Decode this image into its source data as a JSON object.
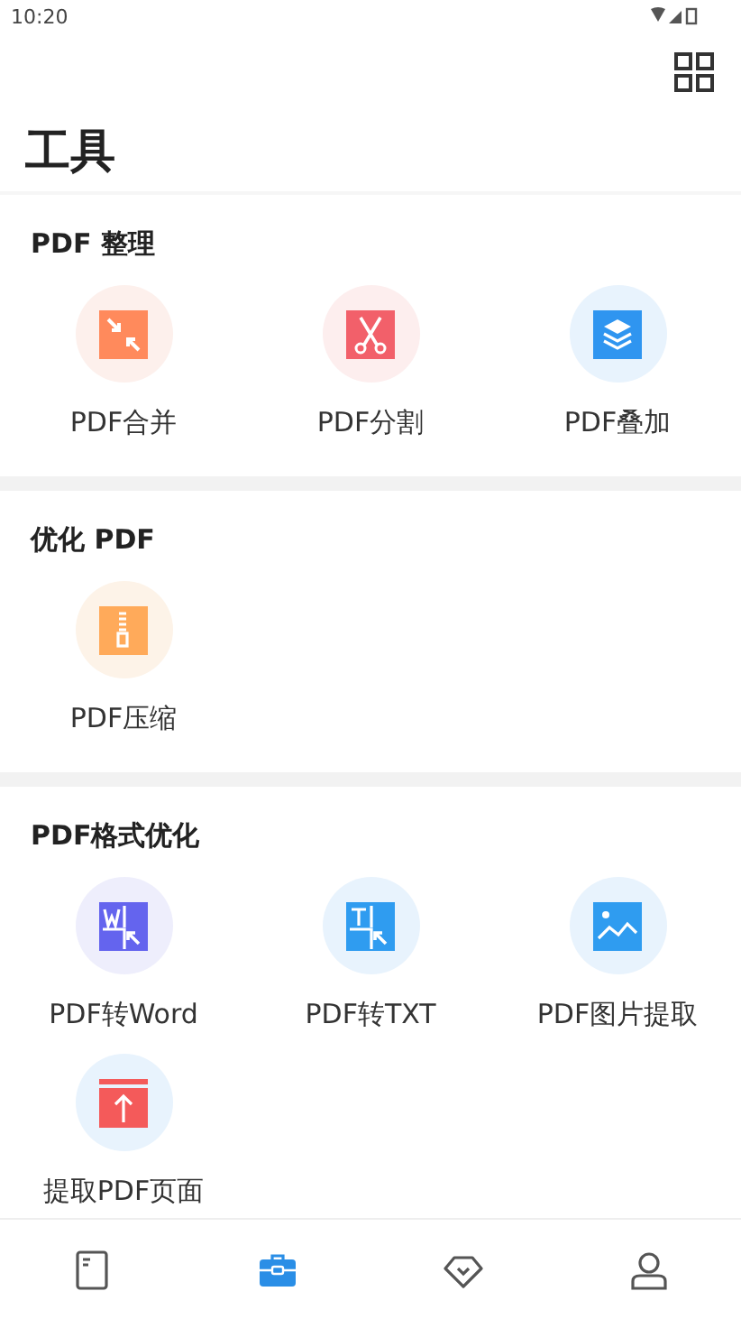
{
  "status_bar": {
    "time": "10:20"
  },
  "title": "工具",
  "sections": [
    {
      "title": "PDF 整理",
      "tools": [
        {
          "kind": "merge",
          "label": "PDF合并"
        },
        {
          "kind": "split",
          "label": "PDF分割"
        },
        {
          "kind": "overlay",
          "label": "PDF叠加"
        }
      ]
    },
    {
      "title": "优化 PDF",
      "tools": [
        {
          "kind": "compress",
          "label": "PDF压缩"
        }
      ]
    },
    {
      "title": "PDF格式优化",
      "tools": [
        {
          "kind": "word",
          "label": "PDF转Word"
        },
        {
          "kind": "txt",
          "label": "PDF转TXT"
        },
        {
          "kind": "image",
          "label": "PDF图片提取"
        },
        {
          "kind": "extract",
          "label": "提取PDF页面"
        }
      ]
    }
  ],
  "nav": [
    {
      "kind": "book",
      "selected": false
    },
    {
      "kind": "toolbox",
      "selected": true
    },
    {
      "kind": "diamond",
      "selected": false
    },
    {
      "kind": "person",
      "selected": false
    }
  ]
}
